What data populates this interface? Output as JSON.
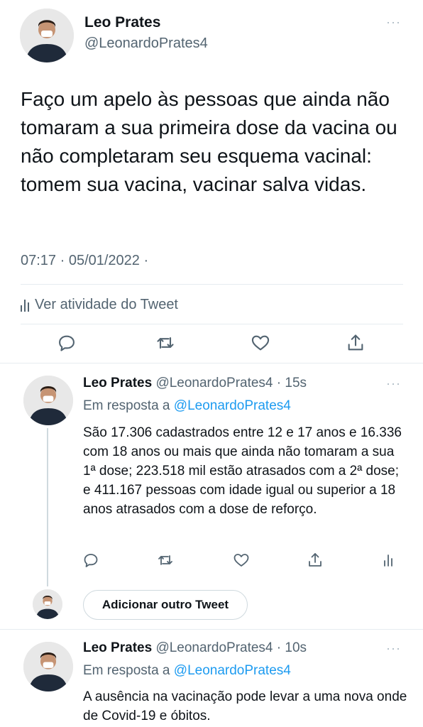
{
  "main_tweet": {
    "name": "Leo Prates",
    "handle": "@LeonardoPrates4",
    "text": "Faço um apelo às pessoas que ainda não tomaram a sua primeira dose da vacina ou não completaram seu esquema vacinal: tomem sua vacina, vacinar salva vidas.",
    "meta": "07:17 · 05/01/2022 ·",
    "activity_label": "Ver atividade do Tweet",
    "more_icon": "more-dots-icon"
  },
  "replies": [
    {
      "name": "Leo Prates",
      "handle_time": "@LeonardoPrates4 · 15s",
      "reply_prefix": "Em resposta a",
      "reply_to": "@LeonardoPrates4",
      "text": "São 17.306 cadastrados entre 12 e 17 anos e 16.336 com 18 anos ou mais que ainda não tomaram a sua 1ª dose; 223.518 mil estão atrasados com a 2ª dose; e 411.167 pessoas com idade igual ou superior a 18 anos atrasados com a dose de reforço."
    },
    {
      "name": "Leo Prates",
      "handle_time": "@LeonardoPrates4 · 10s",
      "reply_prefix": "Em resposta a",
      "reply_to": "@LeonardoPrates4",
      "text": "A ausência na vacinação pode levar a uma nova onde de Covid-19 e óbitos."
    }
  ],
  "composer": {
    "add_button_label": "Adicionar outro Tweet"
  },
  "colors": {
    "text": "#0f1419",
    "secondary": "#536471",
    "accent": "#1d9bf0",
    "divider": "#e6ecf0"
  }
}
